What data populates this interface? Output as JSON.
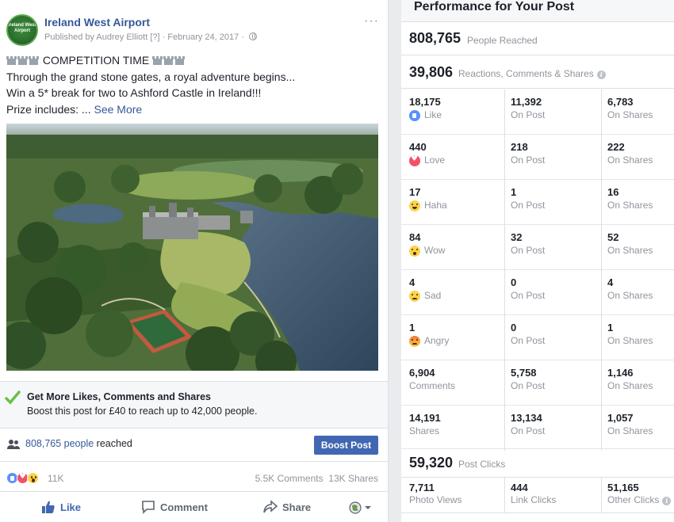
{
  "post": {
    "page_name": "Ireland West Airport",
    "avatar_text": "Ireland West Airport",
    "published_by": "Published by Audrey Elliott",
    "help_marker": "[?]",
    "separator": "·",
    "date": "February 24, 2017",
    "more_menu": "···",
    "headline": "COMPETITION TIME",
    "lines": [
      "Through the grand stone gates, a royal adventure begins...",
      "Win a 5* break for two to Ashford Castle in Ireland!!!",
      "Prize includes: ..."
    ],
    "see_more": "See More",
    "promo_title": "Get More Likes, Comments and Shares",
    "promo_sub": "Boost this post for £40 to reach up to 42,000 people.",
    "reach_number": "808,765 people",
    "reach_suffix": " reached",
    "boost_button": "Boost Post",
    "reaction_count": "11K",
    "comments": "5.5K Comments",
    "shares": "13K Shares",
    "action_like": "Like",
    "action_comment": "Comment",
    "action_share": "Share",
    "colors": {
      "link": "#365899",
      "button": "#4267b2",
      "secondary": "#90949c"
    }
  },
  "performance": {
    "title": "Performance for Your Post",
    "people_reached": "808,765",
    "people_reached_label": "People Reached",
    "reactions_total": "39,806",
    "reactions_label": "Reactions, Comments & Shares",
    "rows": [
      {
        "icon": "like-icon",
        "total": "18,175",
        "label": "Like",
        "on_post": "11,392",
        "on_post_label": "On Post",
        "on_shares": "6,783",
        "on_shares_label": "On Shares"
      },
      {
        "icon": "love-icon",
        "total": "440",
        "label": "Love",
        "on_post": "218",
        "on_post_label": "On Post",
        "on_shares": "222",
        "on_shares_label": "On Shares"
      },
      {
        "icon": "haha-icon",
        "total": "17",
        "label": "Haha",
        "on_post": "1",
        "on_post_label": "On Post",
        "on_shares": "16",
        "on_shares_label": "On Shares"
      },
      {
        "icon": "wow-icon",
        "total": "84",
        "label": "Wow",
        "on_post": "32",
        "on_post_label": "On Post",
        "on_shares": "52",
        "on_shares_label": "On Shares"
      },
      {
        "icon": "sad-icon",
        "total": "4",
        "label": "Sad",
        "on_post": "0",
        "on_post_label": "On Post",
        "on_shares": "4",
        "on_shares_label": "On Shares"
      },
      {
        "icon": "angry-icon",
        "total": "1",
        "label": "Angry",
        "on_post": "0",
        "on_post_label": "On Post",
        "on_shares": "1",
        "on_shares_label": "On Shares"
      },
      {
        "icon": "",
        "total": "6,904",
        "label": "Comments",
        "on_post": "5,758",
        "on_post_label": "On Post",
        "on_shares": "1,146",
        "on_shares_label": "On Shares"
      },
      {
        "icon": "",
        "total": "14,191",
        "label": "Shares",
        "on_post": "13,134",
        "on_post_label": "On Post",
        "on_shares": "1,057",
        "on_shares_label": "On Shares"
      }
    ],
    "post_clicks": "59,320",
    "post_clicks_label": "Post Clicks",
    "clicks": [
      {
        "value": "7,711",
        "label": "Photo Views"
      },
      {
        "value": "444",
        "label": "Link Clicks"
      },
      {
        "value": "51,165",
        "label": "Other Clicks"
      }
    ]
  }
}
